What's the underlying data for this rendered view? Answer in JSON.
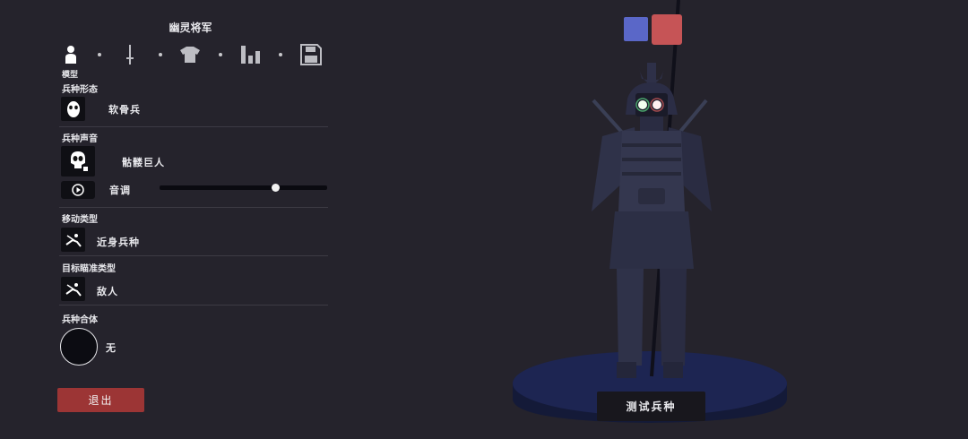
{
  "unit": {
    "name": "幽灵将军"
  },
  "steps": {
    "current_label": "模型",
    "items": [
      {
        "icon": "person-icon"
      },
      {
        "icon": "sword-icon"
      },
      {
        "icon": "shirt-icon"
      },
      {
        "icon": "bar-chart-icon"
      },
      {
        "icon": "save-icon"
      }
    ]
  },
  "sections": {
    "form": {
      "label": "兵种形态",
      "value": "软骨兵",
      "icon": "mask-icon"
    },
    "voice": {
      "label": "兵种声音",
      "value": "骷髅巨人",
      "icon": "skull-icon",
      "pitch_label": "音调",
      "pitch_level": 0.69
    },
    "movement": {
      "label": "移动类型",
      "value": "近身兵种",
      "icon": "melee-icon"
    },
    "targeting": {
      "label": "目标瞄准类型",
      "value": "敌人",
      "icon": "target-icon"
    },
    "combine": {
      "label": "兵种合体",
      "value": "无"
    }
  },
  "buttons": {
    "exit": "退出",
    "test": "测试兵种"
  },
  "team_colors": {
    "blue": "#5a67c8",
    "red": "#c65456"
  },
  "colors": {
    "background": "#25232c",
    "exit_button": "#9c3535"
  }
}
